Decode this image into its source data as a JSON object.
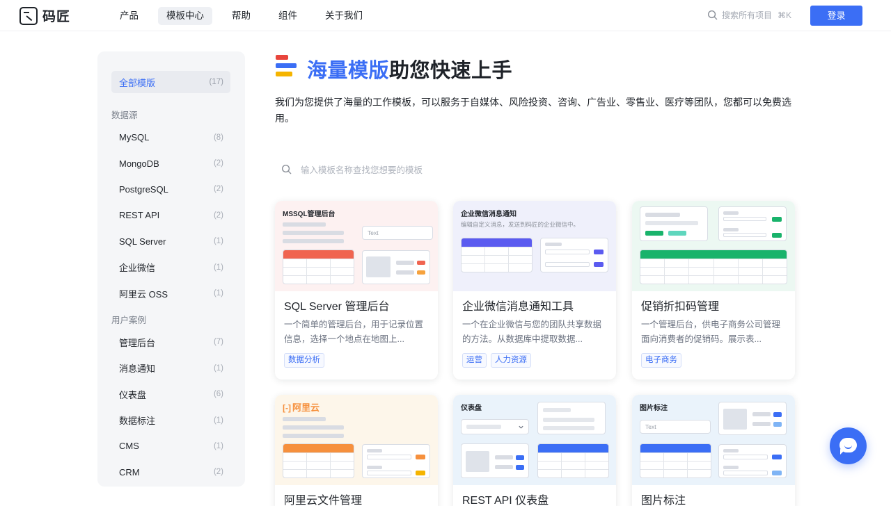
{
  "brand": {
    "name": "码匠"
  },
  "nav": {
    "items": [
      {
        "label": "产品"
      },
      {
        "label": "模板中心",
        "active": true
      },
      {
        "label": "帮助"
      },
      {
        "label": "组件"
      },
      {
        "label": "关于我们"
      }
    ],
    "search_placeholder": "搜索所有项目",
    "search_shortcut": "⌘K",
    "login_label": "登录"
  },
  "sidebar": {
    "all": {
      "label": "全部模版",
      "count": "(17)"
    },
    "groups": [
      {
        "title": "数据源",
        "items": [
          {
            "label": "MySQL",
            "count": "(8)"
          },
          {
            "label": "MongoDB",
            "count": "(2)"
          },
          {
            "label": "PostgreSQL",
            "count": "(2)"
          },
          {
            "label": "REST API",
            "count": "(2)"
          },
          {
            "label": "SQL Server",
            "count": "(1)"
          },
          {
            "label": "企业微信",
            "count": "(1)"
          },
          {
            "label": "阿里云 OSS",
            "count": "(1)"
          }
        ]
      },
      {
        "title": "用户案例",
        "items": [
          {
            "label": "管理后台",
            "count": "(7)"
          },
          {
            "label": "消息通知",
            "count": "(1)"
          },
          {
            "label": "仪表盘",
            "count": "(6)"
          },
          {
            "label": "数据标注",
            "count": "(1)"
          },
          {
            "label": "CMS",
            "count": "(1)"
          },
          {
            "label": "CRM",
            "count": "(2)"
          }
        ]
      }
    ]
  },
  "hero": {
    "title_highlight": "海量模版",
    "title_rest": "助您快速上手",
    "description": "我们为您提供了海量的工作模板，可以服务于自媒体、风险投资、咨询、广告业、零售业、医疗等团队，您都可以免费选用。",
    "icon_colors": [
      "#e8453c",
      "#3b6ef5",
      "#f5b400"
    ]
  },
  "template_search": {
    "placeholder": "输入模板名称查找您想要的模板"
  },
  "cards": [
    {
      "preview_title": "MSSQL管理后台",
      "preview_text": "Text",
      "title": "SQL Server 管理后台",
      "description": "一个简单的管理后台，用于记录位置信息，选择一个地点在地图上...",
      "tags": [
        "数据分析"
      ],
      "accent": "#f06450",
      "bg": "#fdf1f1"
    },
    {
      "preview_title": "企业微信消息通知",
      "preview_subtitle": "编辑自定义消息，发送到码匠的企业微信中。",
      "title": "企业微信消息通知工具",
      "description": "一个在企业微信与您的团队共享数据的方法。从数据库中提取数据...",
      "tags": [
        "运营",
        "人力资源"
      ],
      "accent": "#5b5bf0",
      "bg": "#eff0fb"
    },
    {
      "title": "促销折扣码管理",
      "description": "一个管理后台，供电子商务公司管理面向消费者的促销码。展示表...",
      "tags": [
        "电子商务"
      ],
      "accent": "#19b36b",
      "bg": "#ecf8f2"
    },
    {
      "preview_title": "阿里云",
      "title": "阿里云文件管理",
      "tags": [],
      "accent": "#f6903d",
      "bg": "#fdf6ea"
    },
    {
      "preview_title": "仪表盘",
      "title": "REST API 仪表盘",
      "tags": [],
      "accent": "#3b6ef5",
      "bg": "#eaf3fb"
    },
    {
      "preview_title": "图片标注",
      "preview_text": "Text",
      "title": "图片标注",
      "tags": [],
      "accent": "#3b6ef5",
      "bg": "#eaf3fb"
    }
  ],
  "icons": {
    "logo": "code-craft-logo-icon",
    "search": "search-icon",
    "chat": "chat-bubble-icon",
    "map": "image-placeholder-icon",
    "dropdown": "chevron-down-icon"
  }
}
